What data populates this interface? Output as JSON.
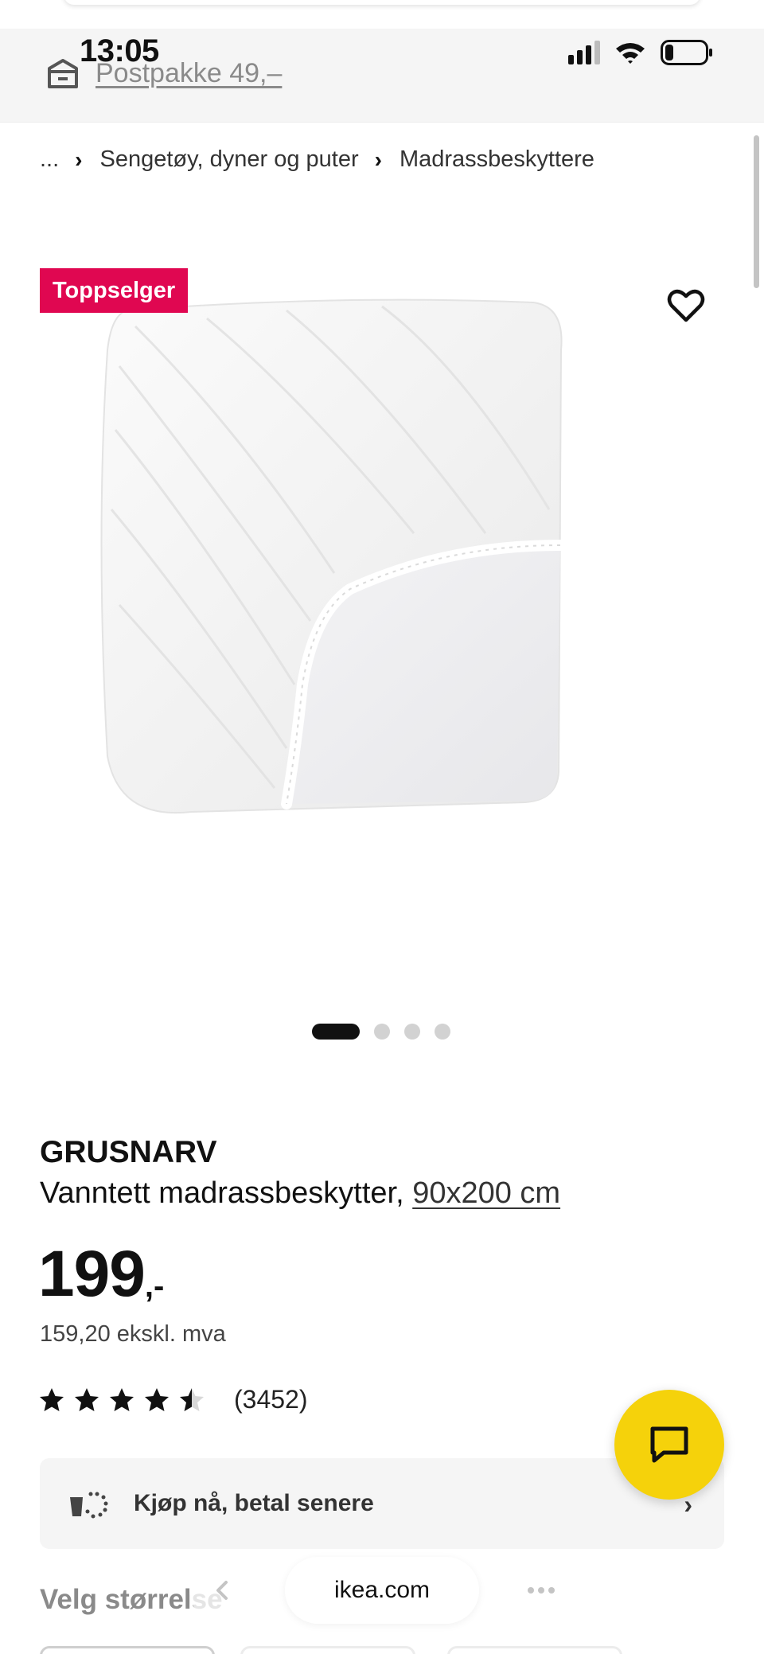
{
  "status_bar": {
    "time": "13:05",
    "signal_icon": "signal-icon",
    "wifi_icon": "wifi-icon",
    "battery_icon": "battery-icon",
    "battery_level": 0.2
  },
  "header": {
    "delivery_icon": "delivery-box-icon",
    "delivery_text": "Postpakke 49,–"
  },
  "breadcrumb": {
    "items": [
      "...",
      "Sengetøy, dyner og puter",
      "Madrassbeskyttere"
    ],
    "separator": "›"
  },
  "product": {
    "badge": "Toppselger",
    "badge_color": "#e00751",
    "favorite_icon": "heart-icon",
    "image_description_icon": "mattress-protector-image",
    "carousel": {
      "count": 4,
      "active_index": 0
    },
    "brand": "GRUSNARV",
    "description": "Vanntett madrassbeskytter,",
    "size_link": "90x200 cm",
    "price_value": "199",
    "price_suffix": ",-",
    "price_ex_vat": "159,20 ekskl. mva",
    "rating_value": 4.5,
    "rating_max": 5,
    "rating_count": "(3452)"
  },
  "bnpl": {
    "icon": "buy-now-pay-later-icon",
    "label": "Kjøp nå, betal senere",
    "chevron": "›"
  },
  "size_section": {
    "heading": "Velg størrelse"
  },
  "chat_button": {
    "icon": "chat-bubble-icon",
    "color": "#f5d20b"
  },
  "browser": {
    "url": "ikea.com",
    "back_icon": "chevron-left-icon",
    "more_icon": "more-icon"
  }
}
